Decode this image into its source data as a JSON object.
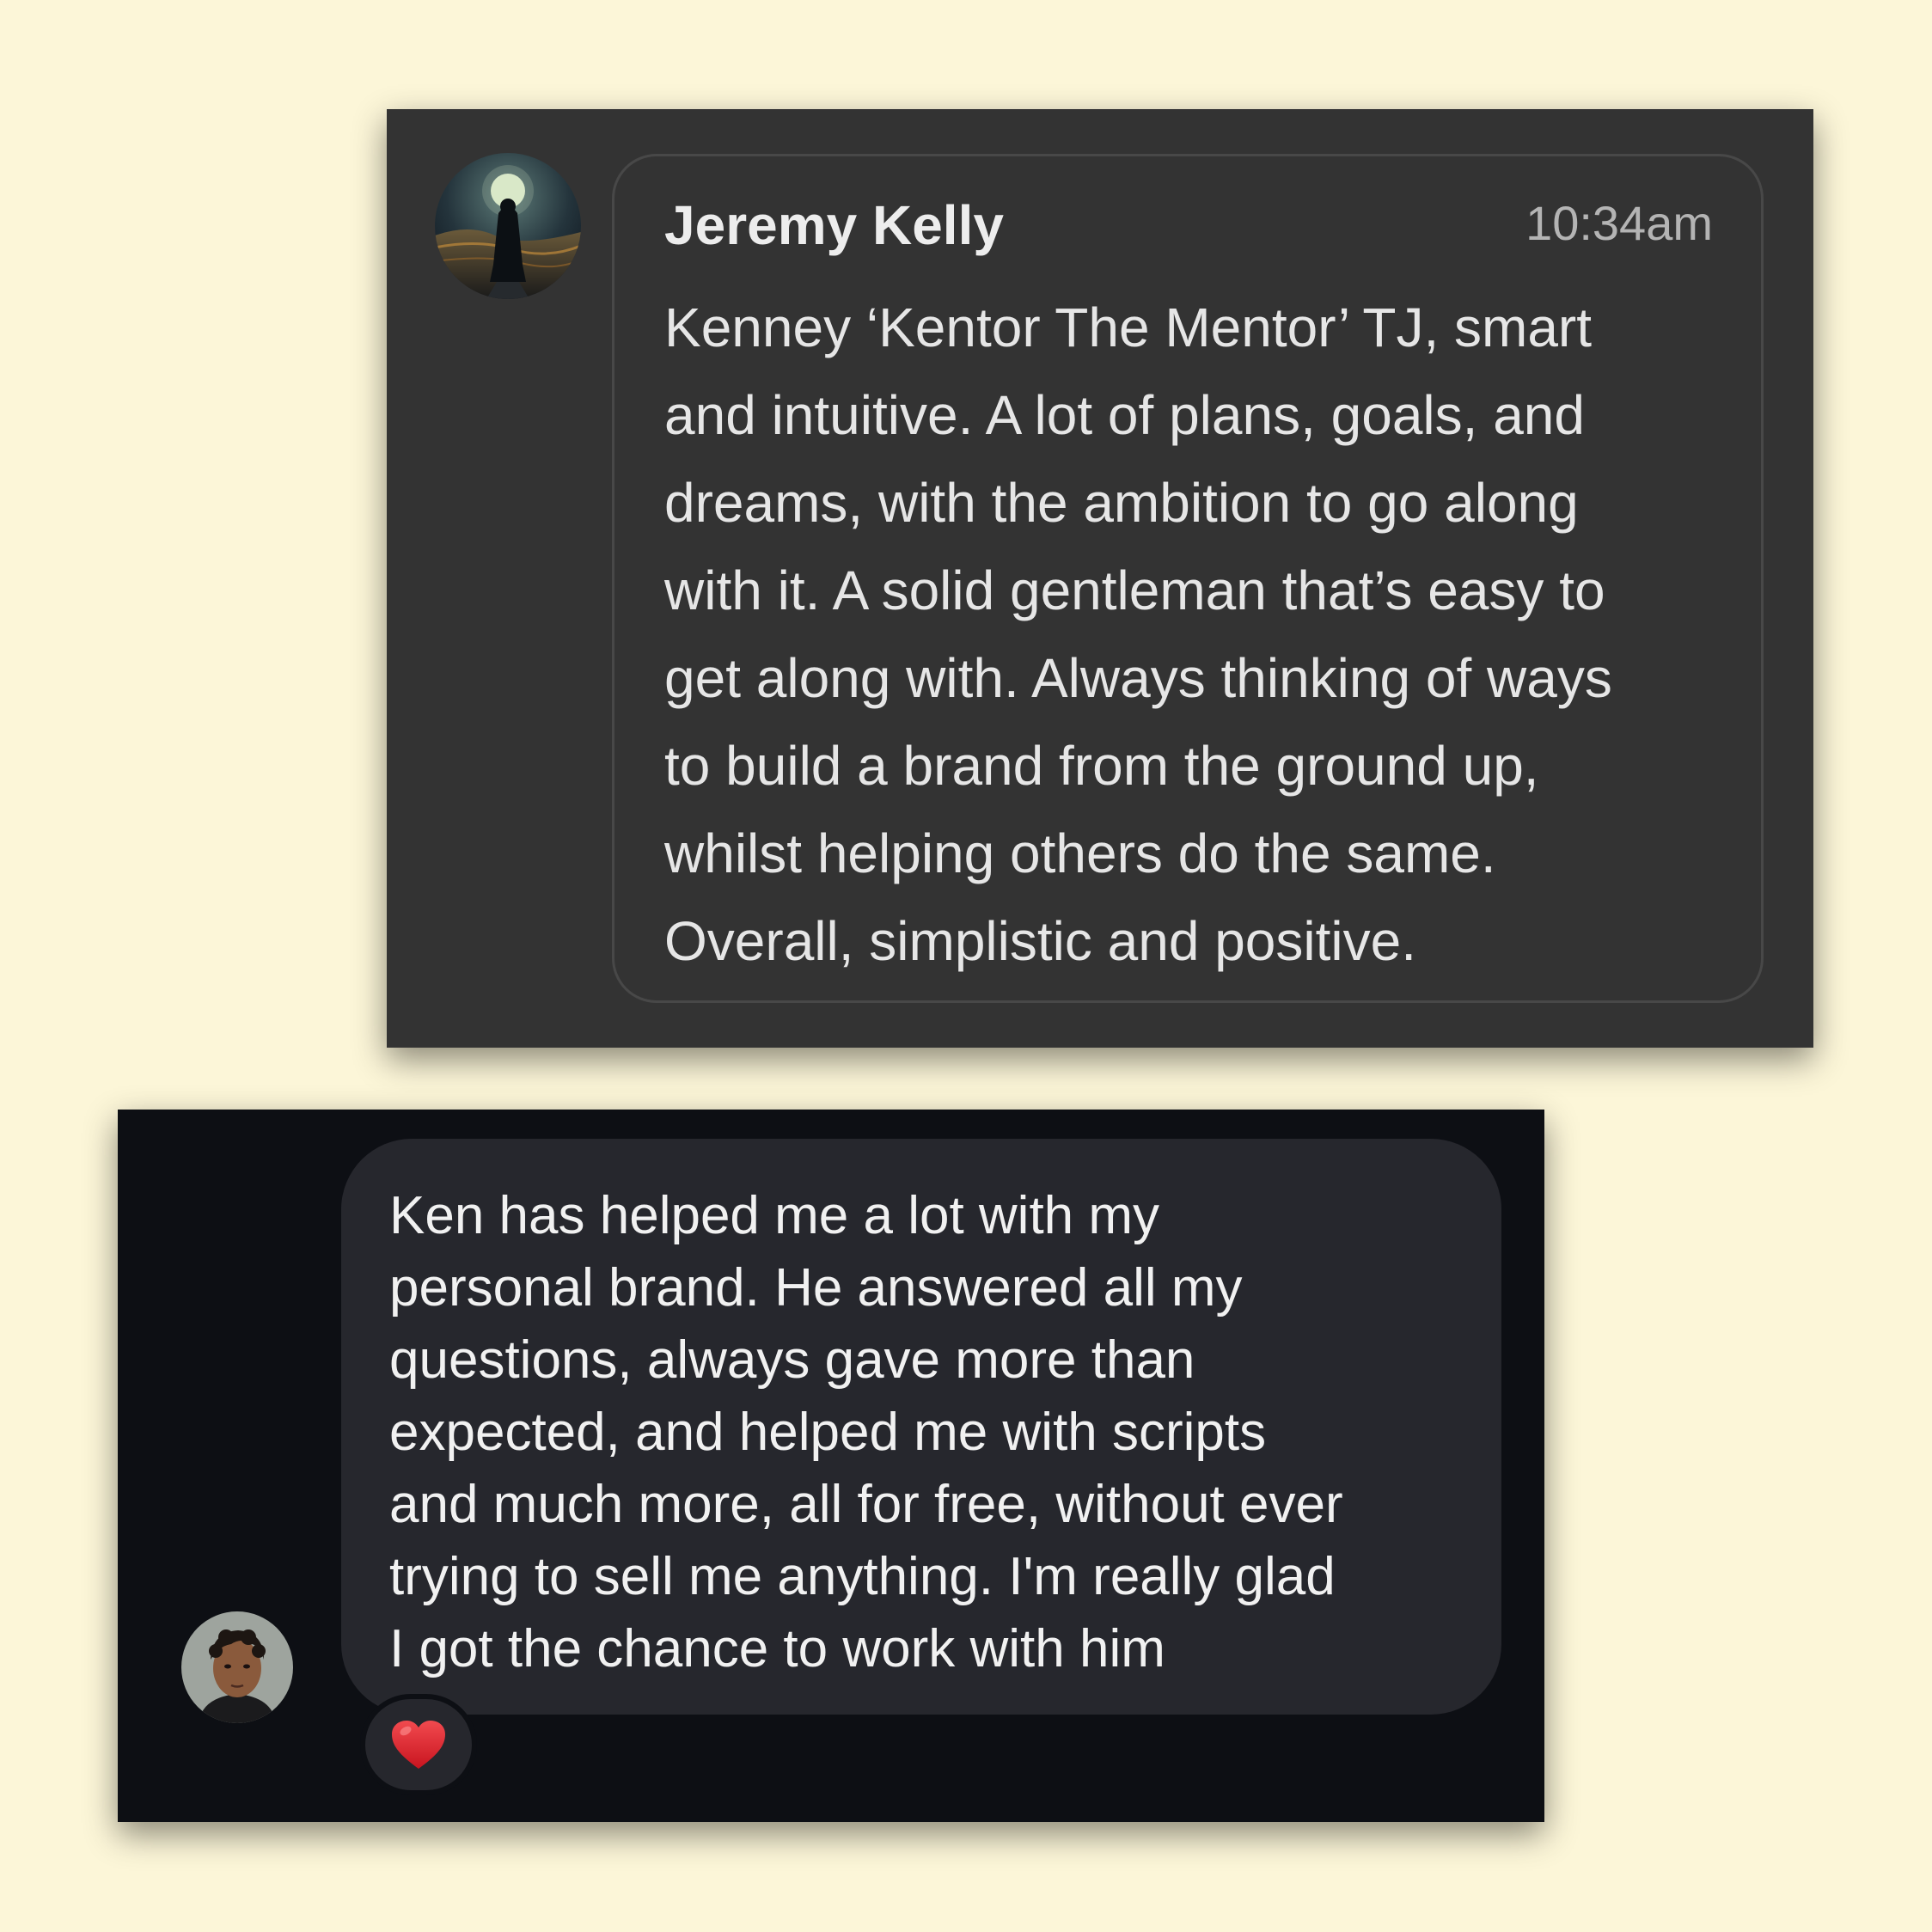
{
  "card1": {
    "sender_name": "Jeremy Kelly",
    "timestamp": "10:34am",
    "avatar_icon": "hooded-figure-moon-avatar",
    "message_lines": [
      "Kenney ‘Kentor The Mentor’ TJ, smart",
      "and intuitive. A lot of plans, goals, and",
      "dreams, with the ambition to go along",
      "with it. A solid gentleman that’s easy to",
      "get along with. Always thinking of ways",
      "to build a brand from the ground up,",
      "whilst helping others do the same.",
      "Overall, simplistic and positive."
    ]
  },
  "card2": {
    "avatar_icon": "person-portrait-avatar",
    "message_lines": [
      "Ken has helped me a lot with my",
      "personal brand. He answered all my",
      "questions, always gave more than",
      "expected, and helped me with scripts",
      "and much more, all for free, without ever",
      "trying to sell me anything. I'm really glad",
      "I got the chance to work with him"
    ],
    "reaction_icon": "red-heart-icon"
  },
  "colors": {
    "page_background": "#fcf6d8",
    "card1_background": "#333333",
    "card2_background": "#0d0f14",
    "bubble2_background": "#26272d",
    "heart": "#e0242f"
  }
}
